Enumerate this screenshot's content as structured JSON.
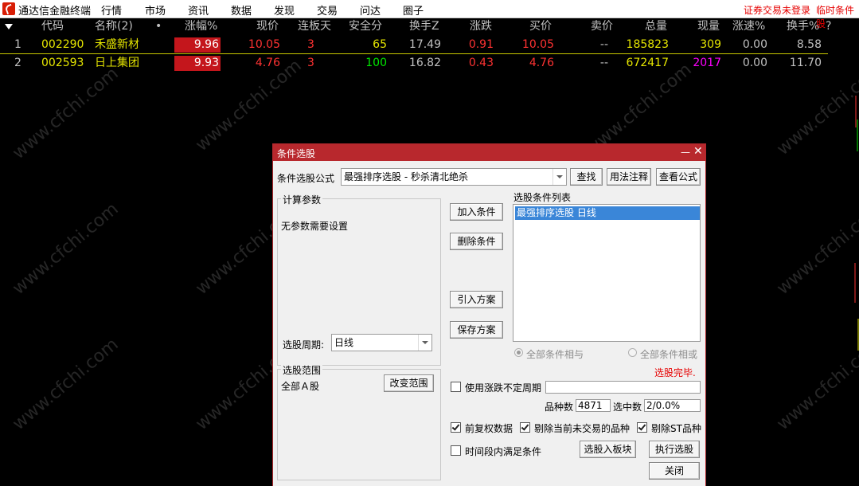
{
  "app": {
    "name": "通达信金融终端"
  },
  "menu": [
    "行情",
    "市场",
    "资讯",
    "数据",
    "发现",
    "交易",
    "问达",
    "圈子"
  ],
  "status": {
    "login": "证券交易未登录",
    "temp": "临时条件股"
  },
  "table": {
    "headers": {
      "code": "代码",
      "name": "名称(2)",
      "dot": "•",
      "pct": "涨幅%",
      "price": "现价",
      "limit_days": "连板天",
      "safety": "安全分",
      "turnover_z": "换手Z",
      "change": "涨跌",
      "bid": "买价",
      "ask": "卖价",
      "volume": "总量",
      "cur_vol": "现量",
      "speed": "涨速%",
      "turnover": "换手%",
      "q": "?"
    },
    "rows": [
      {
        "idx": "1",
        "code": "002290",
        "name": "禾盛新材",
        "pct": "9.96",
        "price": "10.05",
        "limit_days": "3",
        "safety": "65",
        "turnover_z": "17.49",
        "change": "0.91",
        "bid": "10.05",
        "ask": "--",
        "volume": "185823",
        "cur_vol": "309",
        "speed": "0.00",
        "turnover": "8.58"
      },
      {
        "idx": "2",
        "code": "002593",
        "name": "日上集团",
        "pct": "9.93",
        "price": "4.76",
        "limit_days": "3",
        "safety": "100",
        "turnover_z": "16.82",
        "change": "0.43",
        "bid": "4.76",
        "ask": "--",
        "volume": "672417",
        "cur_vol": "2017",
        "speed": "0.00",
        "turnover": "11.70"
      }
    ]
  },
  "dialog": {
    "title": "条件选股",
    "formula_label": "条件选股公式",
    "formula_value": "最强排序选股 - 秒杀清北绝杀",
    "btn_find": "查找",
    "btn_usage": "用法注释",
    "btn_view": "查看公式",
    "params_title": "计算参数",
    "params_text": "无参数需要设置",
    "btn_add": "加入条件",
    "btn_delete": "删除条件",
    "btn_import": "引入方案",
    "btn_save": "保存方案",
    "cond_list_title": "选股条件列表",
    "cond_items": [
      "最强排序选股  日线"
    ],
    "period_label": "选股周期:",
    "period_value": "日线",
    "radio_and": "全部条件相与",
    "radio_or": "全部条件相或",
    "done_text": "选股完毕.",
    "scope_title": "选股范围",
    "scope_value": "全部Ａ股",
    "btn_change_scope": "改变范围",
    "chk_indefinite": "使用涨跌不定周期",
    "count_label": "品种数",
    "count_value": "4871",
    "selected_label": "选中数",
    "selected_value": "2/0.0%",
    "chk_adjust": "前复权数据",
    "chk_exclude_untraded": "剔除当前未交易的品种",
    "chk_exclude_st": "剔除ST品种",
    "chk_time_range": "时间段内满足条件",
    "btn_to_block": "选股入板块",
    "btn_execute": "执行选股",
    "btn_close": "关闭"
  },
  "watermark": "www.cfchi.com",
  "colors": {
    "up_red": "#ff3232",
    "yellow": "#e6e600",
    "green": "#00e600",
    "purple": "#ff00ff",
    "title_red": "#b8282d"
  }
}
